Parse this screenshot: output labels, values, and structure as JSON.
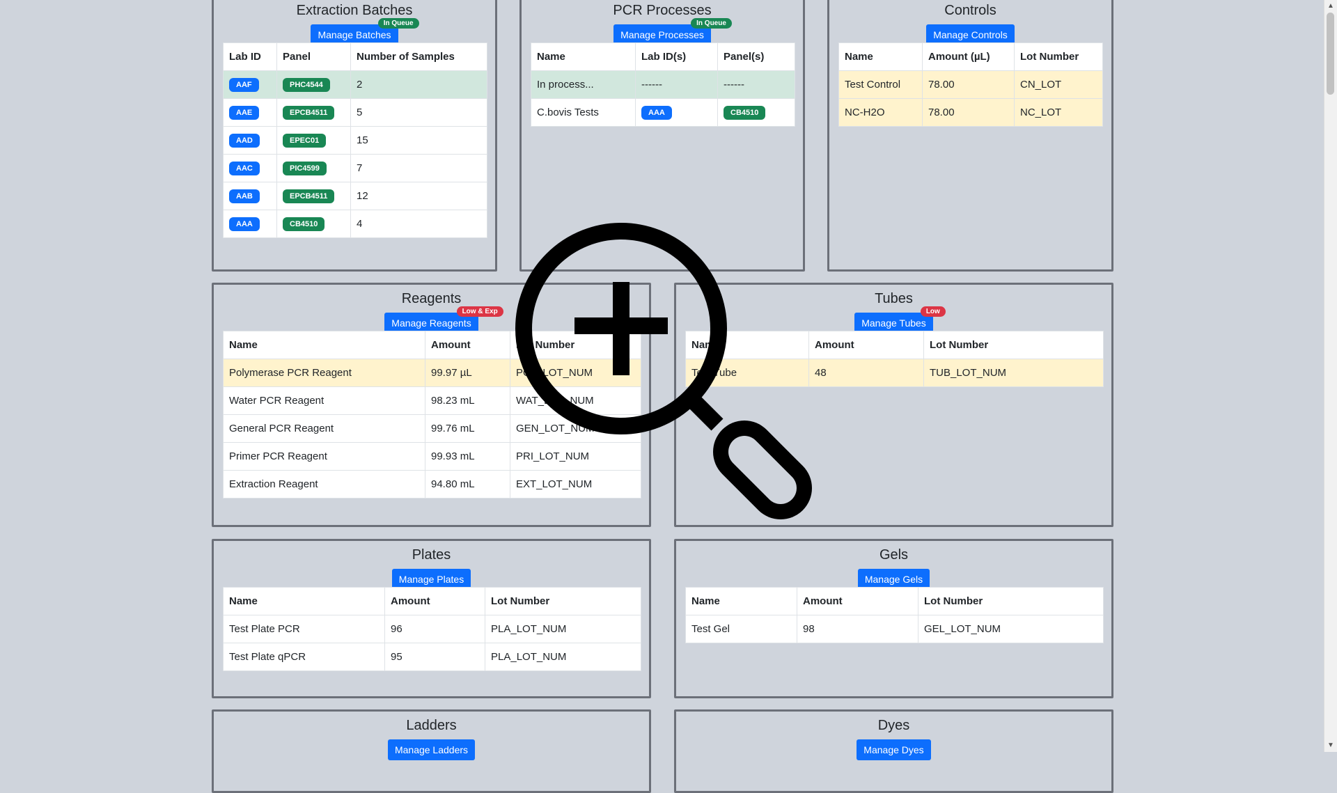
{
  "extraction": {
    "title": "Extraction Batches",
    "button": "Manage Batches",
    "badge": "In Queue",
    "headers": [
      "Lab ID",
      "Panel",
      "Number of Samples"
    ],
    "rows": [
      {
        "lab_id": "AAF",
        "panel": "PHC4544",
        "samples": "2"
      },
      {
        "lab_id": "AAE",
        "panel": "EPCB4511",
        "samples": "5"
      },
      {
        "lab_id": "AAD",
        "panel": "EPEC01",
        "samples": "15"
      },
      {
        "lab_id": "AAC",
        "panel": "PIC4599",
        "samples": "7"
      },
      {
        "lab_id": "AAB",
        "panel": "EPCB4511",
        "samples": "12"
      },
      {
        "lab_id": "AAA",
        "panel": "CB4510",
        "samples": "4"
      }
    ]
  },
  "pcr": {
    "title": "PCR Processes",
    "button": "Manage Processes",
    "badge": "In Queue",
    "headers": [
      "Name",
      "Lab ID(s)",
      "Panel(s)"
    ],
    "rows": [
      {
        "name": "In process...",
        "lab_ids": "------",
        "panels": "------"
      },
      {
        "name": "C.bovis Tests",
        "lab_ids": "AAA",
        "panels": "CB4510"
      }
    ]
  },
  "controls": {
    "title": "Controls",
    "button": "Manage Controls",
    "headers": [
      "Name",
      "Amount (µL)",
      "Lot Number"
    ],
    "rows": [
      {
        "name": "Test Control",
        "amount": "78.00",
        "lot": "CN_LOT"
      },
      {
        "name": "NC-H2O",
        "amount": "78.00",
        "lot": "NC_LOT"
      }
    ]
  },
  "reagents": {
    "title": "Reagents",
    "button": "Manage Reagents",
    "badge": "Low & Exp",
    "headers": [
      "Name",
      "Amount",
      "Lot Number"
    ],
    "rows": [
      {
        "name": "Polymerase PCR Reagent",
        "amount": "99.97 µL",
        "lot": "POL_LOT_NUM"
      },
      {
        "name": "Water PCR Reagent",
        "amount": "98.23 mL",
        "lot": "WAT_LOT_NUM"
      },
      {
        "name": "General PCR Reagent",
        "amount": "99.76 mL",
        "lot": "GEN_LOT_NUM"
      },
      {
        "name": "Primer PCR Reagent",
        "amount": "99.93 mL",
        "lot": "PRI_LOT_NUM"
      },
      {
        "name": "Extraction Reagent",
        "amount": "94.80 mL",
        "lot": "EXT_LOT_NUM"
      }
    ]
  },
  "tubes": {
    "title": "Tubes",
    "button": "Manage Tubes",
    "badge": "Low",
    "headers": [
      "Name",
      "Amount",
      "Lot Number"
    ],
    "rows": [
      {
        "name": "Test Tube",
        "amount": "48",
        "lot": "TUB_LOT_NUM"
      }
    ]
  },
  "plates": {
    "title": "Plates",
    "button": "Manage Plates",
    "headers": [
      "Name",
      "Amount",
      "Lot Number"
    ],
    "rows": [
      {
        "name": "Test Plate PCR",
        "amount": "96",
        "lot": "PLA_LOT_NUM"
      },
      {
        "name": "Test Plate qPCR",
        "amount": "95",
        "lot": "PLA_LOT_NUM"
      }
    ]
  },
  "gels": {
    "title": "Gels",
    "button": "Manage Gels",
    "headers": [
      "Name",
      "Amount",
      "Lot Number"
    ],
    "rows": [
      {
        "name": "Test Gel",
        "amount": "98",
        "lot": "GEL_LOT_NUM"
      }
    ]
  },
  "ladders": {
    "title": "Ladders",
    "button": "Manage Ladders"
  },
  "dyes": {
    "title": "Dyes",
    "button": "Manage Dyes"
  },
  "overlay": {
    "icon": "zoom-in-magnifier-icon"
  },
  "colors": {
    "primary": "#0d6efd",
    "success": "#198754",
    "danger": "#dc3545",
    "row_success": "#d1e7dd",
    "row_warning": "#fff3cd",
    "page_bg": "#cfd4dc"
  }
}
